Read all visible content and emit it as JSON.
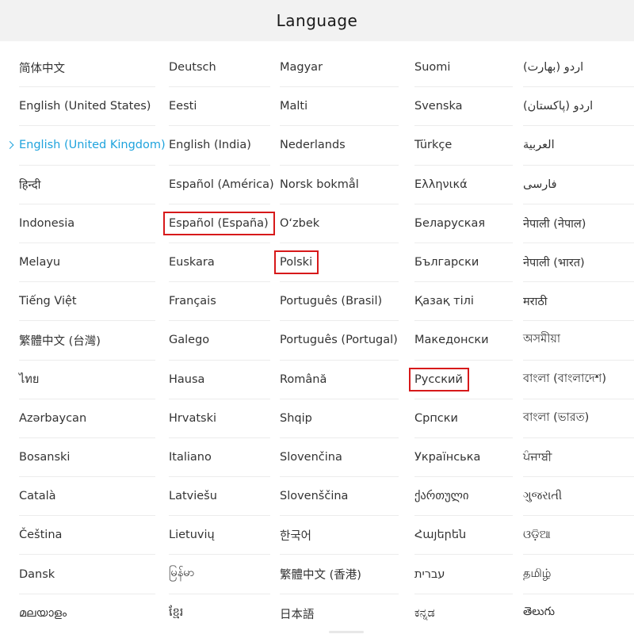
{
  "header": {
    "title": "Language"
  },
  "selected_language": "English (United Kingdom)",
  "highlighted": [
    "Español (España)",
    "Polski",
    "Русский"
  ],
  "colors": {
    "selected": "#1fa3dd",
    "highlight_box": "#d7191a",
    "header_bg": "#f2f2f2"
  },
  "columns": [
    {
      "items": [
        "简体中文",
        "English (United States)",
        "English (United Kingdom)",
        "हिन्दी",
        "Indonesia",
        "Melayu",
        "Tiếng Việt",
        "繁體中文 (台灣)",
        "ไทย",
        "Azərbaycan",
        "Bosanski",
        "Català",
        "Čeština",
        "Dansk",
        "മലയാളം"
      ]
    },
    {
      "items": [
        "Deutsch",
        "Eesti",
        "English (India)",
        "Español (América)",
        "Español (España)",
        "Euskara",
        "Français",
        "Galego",
        "Hausa",
        "Hrvatski",
        "Italiano",
        "Latviešu",
        "Lietuvių",
        "မြန်မာ",
        "ខ្មែរ"
      ]
    },
    {
      "items": [
        "Magyar",
        "Malti",
        "Nederlands",
        "Norsk bokmål",
        "O‘zbek",
        "Polski",
        "Português (Brasil)",
        "Português (Portugal)",
        "Română",
        "Shqip",
        "Slovenčina",
        "Slovenščina",
        "한국어",
        "繁體中文 (香港)",
        "日本語"
      ]
    },
    {
      "items": [
        "Suomi",
        "Svenska",
        "Türkçe",
        "Ελληνικά",
        "Беларуская",
        "Български",
        "Қазақ тілі",
        "Македонски",
        "Русский",
        "Српски",
        "Українська",
        "ქართული",
        "Հայերեն",
        "עברית",
        "ಕನ್ನಡ"
      ]
    },
    {
      "items": [
        "اردو (بھارت)",
        "اردو (پاکستان)",
        "العربية",
        "فارسی",
        "नेपाली (नेपाल)",
        "नेपाली (भारत)",
        "मराठी",
        "অসমীয়া",
        "বাংলা (বাংলাদেশ)",
        "বাংলা (ভারত)",
        "ਪੰਜਾਬੀ",
        "ગુજરાતી",
        "ଓଡ଼ିଆ",
        "தமிழ்",
        "తెలుగు"
      ]
    }
  ]
}
